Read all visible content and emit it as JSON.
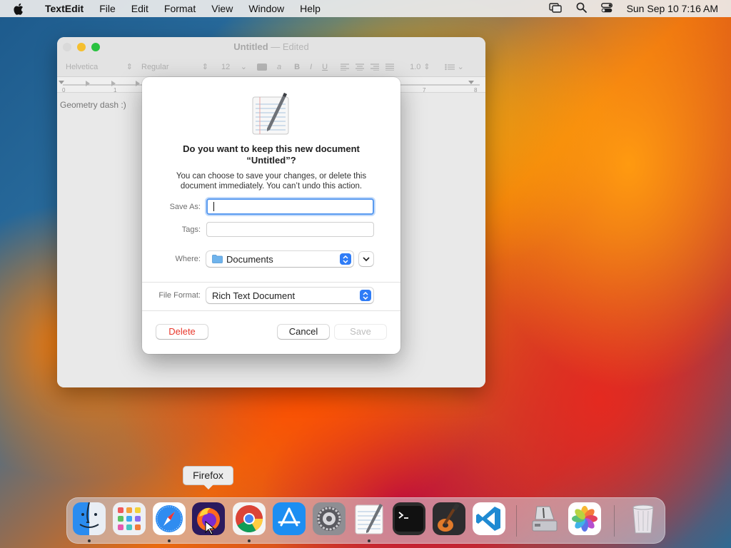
{
  "menubar": {
    "app_name": "TextEdit",
    "items": [
      "File",
      "Edit",
      "Format",
      "View",
      "Window",
      "Help"
    ],
    "clock": "Sun Sep 10  7:16 AM"
  },
  "window": {
    "title": "Untitled",
    "title_suffix": " — Edited",
    "font_family": "Helvetica",
    "font_style": "Regular",
    "font_size": "12",
    "line_spacing": "1.0",
    "ruler_ticks": [
      "0",
      "1",
      "7",
      "8"
    ],
    "document_text": "Geometry dash :)"
  },
  "dialog": {
    "title_line1": "Do you want to keep this new document",
    "title_line2": "“Untitled”?",
    "message_line1": "You can choose to save your changes, or delete this",
    "message_line2": "document immediately. You can’t undo this action.",
    "save_as_label": "Save As:",
    "save_as_value": "",
    "tags_label": "Tags:",
    "where_label": "Where:",
    "where_value": "Documents",
    "format_label": "File Format:",
    "format_value": "Rich Text Document",
    "delete_label": "Delete",
    "cancel_label": "Cancel",
    "save_label": "Save"
  },
  "tooltip": "Firefox",
  "dock": {
    "apps": [
      "finder-icon",
      "launchpad-icon",
      "safari-icon",
      "firefox-icon",
      "chrome-icon",
      "app-store-icon",
      "system-settings-icon",
      "textedit-icon",
      "terminal-icon",
      "garageband-icon",
      "vscode-icon",
      "disk-utility-icon",
      "photos-icon",
      "trash-icon"
    ]
  },
  "colors": {
    "accent": "#2f7cf6",
    "delete": "#e8372b"
  }
}
